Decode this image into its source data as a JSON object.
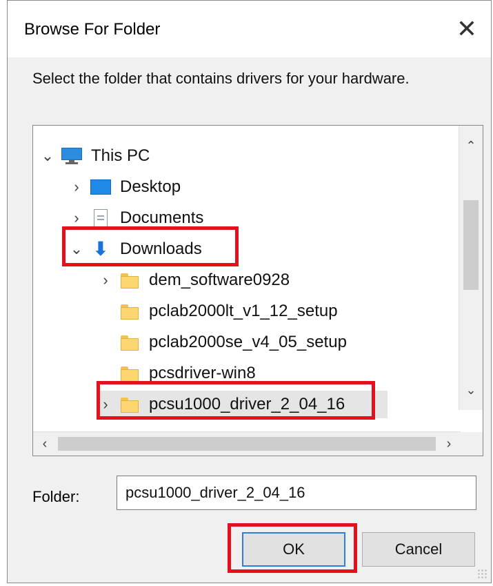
{
  "dialog": {
    "title": "Browse For Folder",
    "close_glyph": "✕",
    "instruction": "Select the folder that contains drivers for your hardware."
  },
  "tree": {
    "items": [
      {
        "label": "This PC",
        "icon": "monitor-icon",
        "expand": "expanded"
      },
      {
        "label": "Desktop",
        "icon": "desktop-icon",
        "expand": "collapsed"
      },
      {
        "label": "Documents",
        "icon": "documents-icon",
        "expand": "collapsed"
      },
      {
        "label": "Downloads",
        "icon": "download-arrow-icon",
        "expand": "expanded"
      },
      {
        "label": "dem_software0928",
        "icon": "folder-icon",
        "expand": "collapsed"
      },
      {
        "label": "pclab2000lt_v1_12_setup",
        "icon": "folder-icon",
        "expand": "none"
      },
      {
        "label": "pclab2000se_v4_05_setup",
        "icon": "folder-icon",
        "expand": "none"
      },
      {
        "label": "pcsdriver-win8",
        "icon": "folder-icon",
        "expand": "none"
      },
      {
        "label": "pcsu1000_driver_2_04_16",
        "icon": "folder-icon",
        "expand": "collapsed",
        "selected": true
      }
    ]
  },
  "folder_field": {
    "label": "Folder:",
    "value": "pcsu1000_driver_2_04_16"
  },
  "buttons": {
    "ok": "OK",
    "cancel": "Cancel"
  },
  "colors": {
    "highlight": "#e3101e",
    "accent": "#2f7fd8"
  }
}
